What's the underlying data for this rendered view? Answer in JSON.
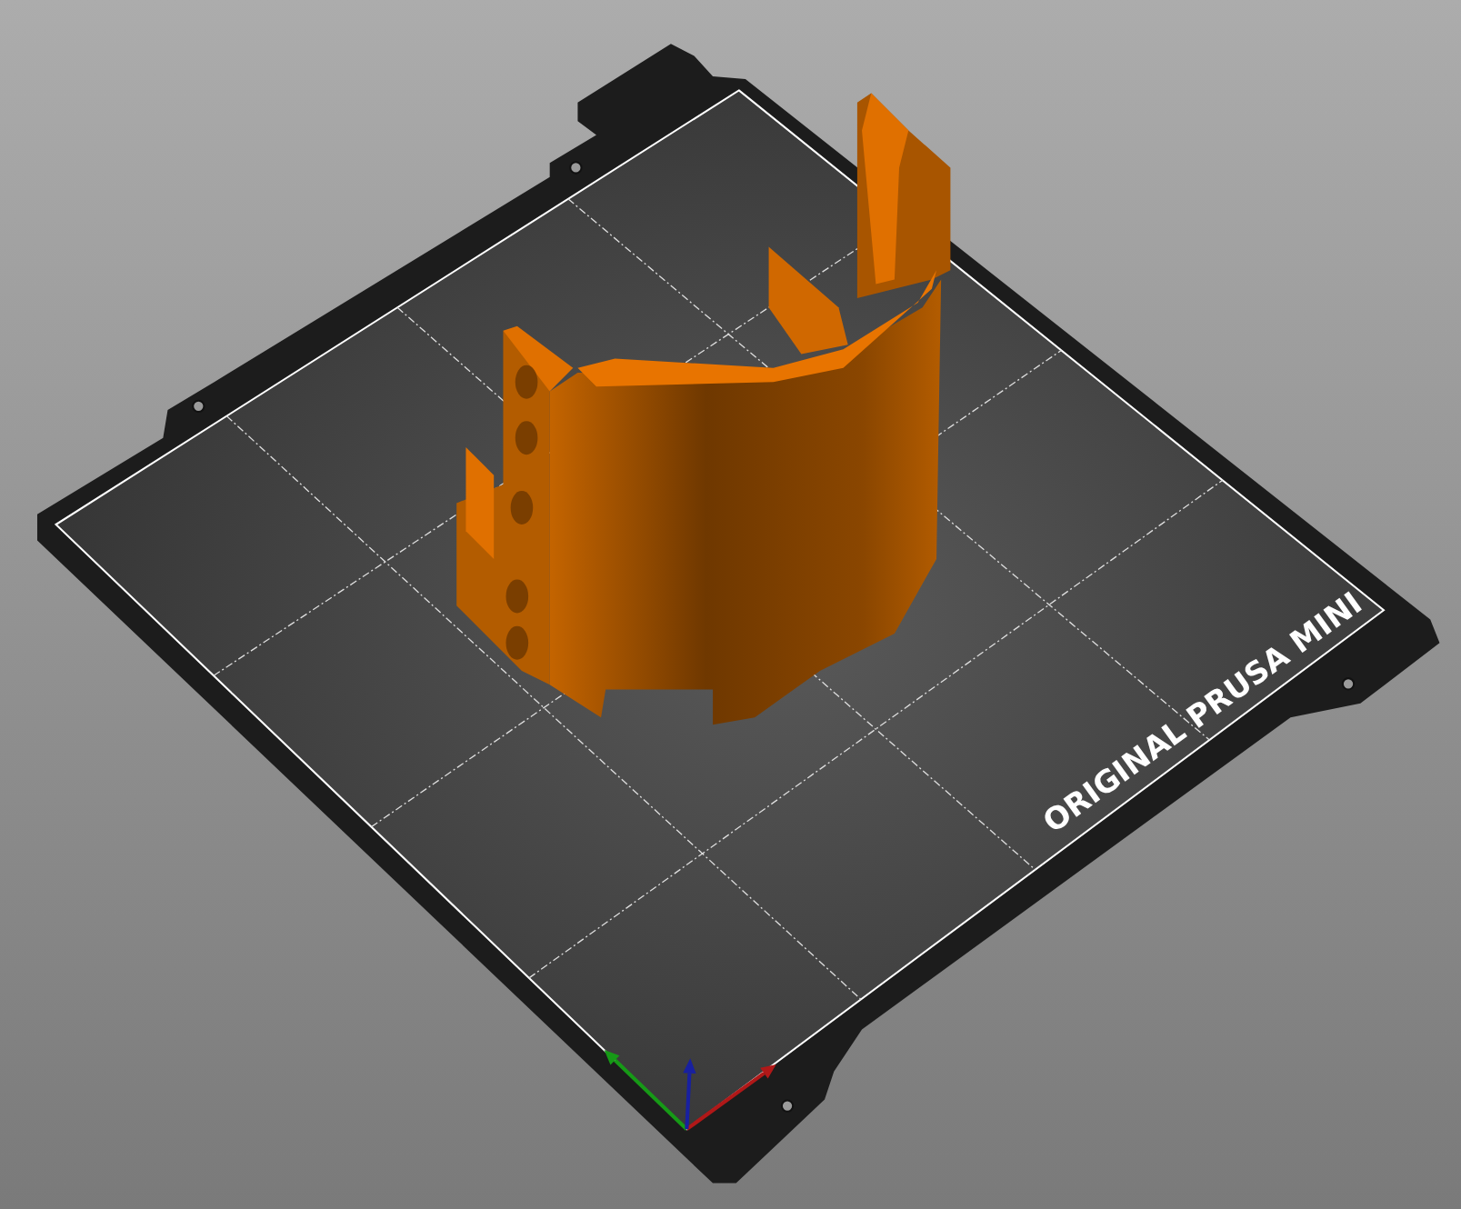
{
  "viewport": {
    "bed_label_words": [
      "ORIGINAL",
      "PRUSA",
      "MINI"
    ]
  }
}
